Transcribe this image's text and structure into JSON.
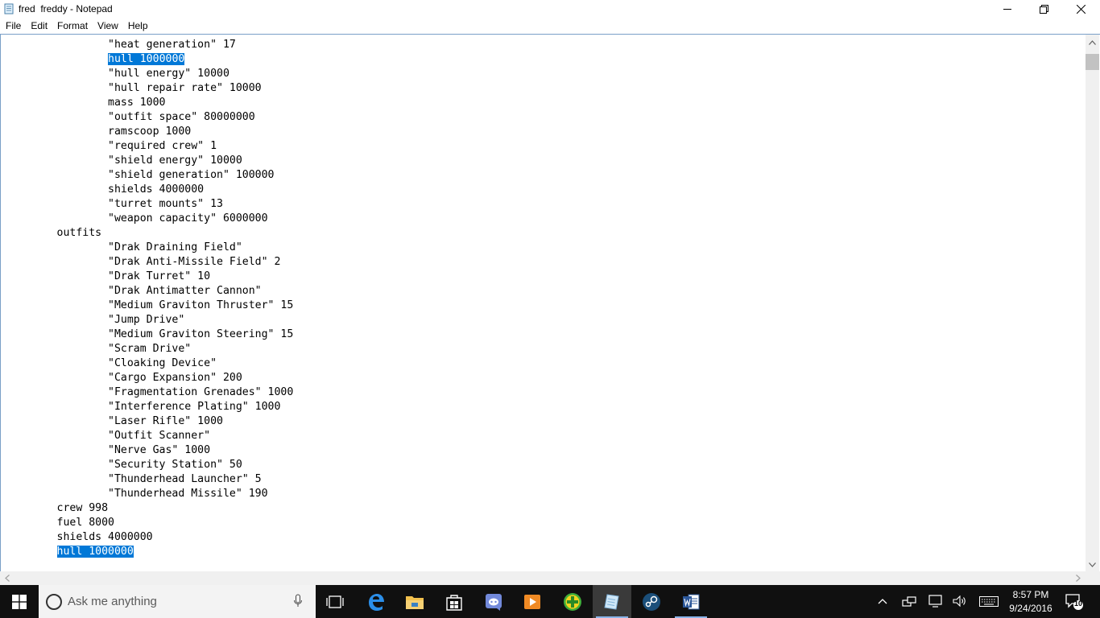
{
  "window": {
    "title": "fred  freddy - Notepad"
  },
  "menu": [
    "File",
    "Edit",
    "Format",
    "View",
    "Help"
  ],
  "editor": {
    "selected_text": "hull 1000000",
    "lines": [
      "\t\t\"heat generation\" 17",
      "\t\thull 1000000",
      "\t\t\"hull energy\" 10000",
      "\t\t\"hull repair rate\" 10000",
      "\t\tmass 1000",
      "\t\t\"outfit space\" 80000000",
      "\t\tramscoop 1000",
      "\t\t\"required crew\" 1",
      "\t\t\"shield energy\" 10000",
      "\t\t\"shield generation\" 100000",
      "\t\tshields 4000000",
      "\t\t\"turret mounts\" 13",
      "\t\t\"weapon capacity\" 6000000",
      "\toutfits",
      "\t\t\"Drak Draining Field\"",
      "\t\t\"Drak Anti-Missile Field\" 2",
      "\t\t\"Drak Turret\" 10",
      "\t\t\"Drak Antimatter Cannon\"",
      "\t\t\"Medium Graviton Thruster\" 15",
      "\t\t\"Jump Drive\"",
      "\t\t\"Medium Graviton Steering\" 15",
      "\t\t\"Scram Drive\"",
      "\t\t\"Cloaking Device\"",
      "\t\t\"Cargo Expansion\" 200",
      "\t\t\"Fragmentation Grenades\" 1000",
      "\t\t\"Interference Plating\" 1000",
      "\t\t\"Laser Rifle\" 1000",
      "\t\t\"Outfit Scanner\"",
      "\t\t\"Nerve Gas\" 1000",
      "\t\t\"Security Station\" 50",
      "\t\t\"Thunderhead Launcher\" 5",
      "\t\t\"Thunderhead Missile\" 190",
      "\tcrew 998",
      "\tfuel 8000",
      "\tshields 4000000",
      "\thull 1000000"
    ]
  },
  "taskbar": {
    "search_placeholder": "Ask me anything",
    "apps": [
      "task-view",
      "edge",
      "file-explorer",
      "store",
      "discord",
      "media-player",
      "plus-app",
      "notepad",
      "steam",
      "word"
    ],
    "active_app": "notepad",
    "time": "8:57 PM",
    "date": "9/24/2016",
    "notification_count": "10"
  },
  "colors": {
    "selection": "#0078d7",
    "taskbar": "#101010",
    "editor_border": "#7a9fc7"
  }
}
